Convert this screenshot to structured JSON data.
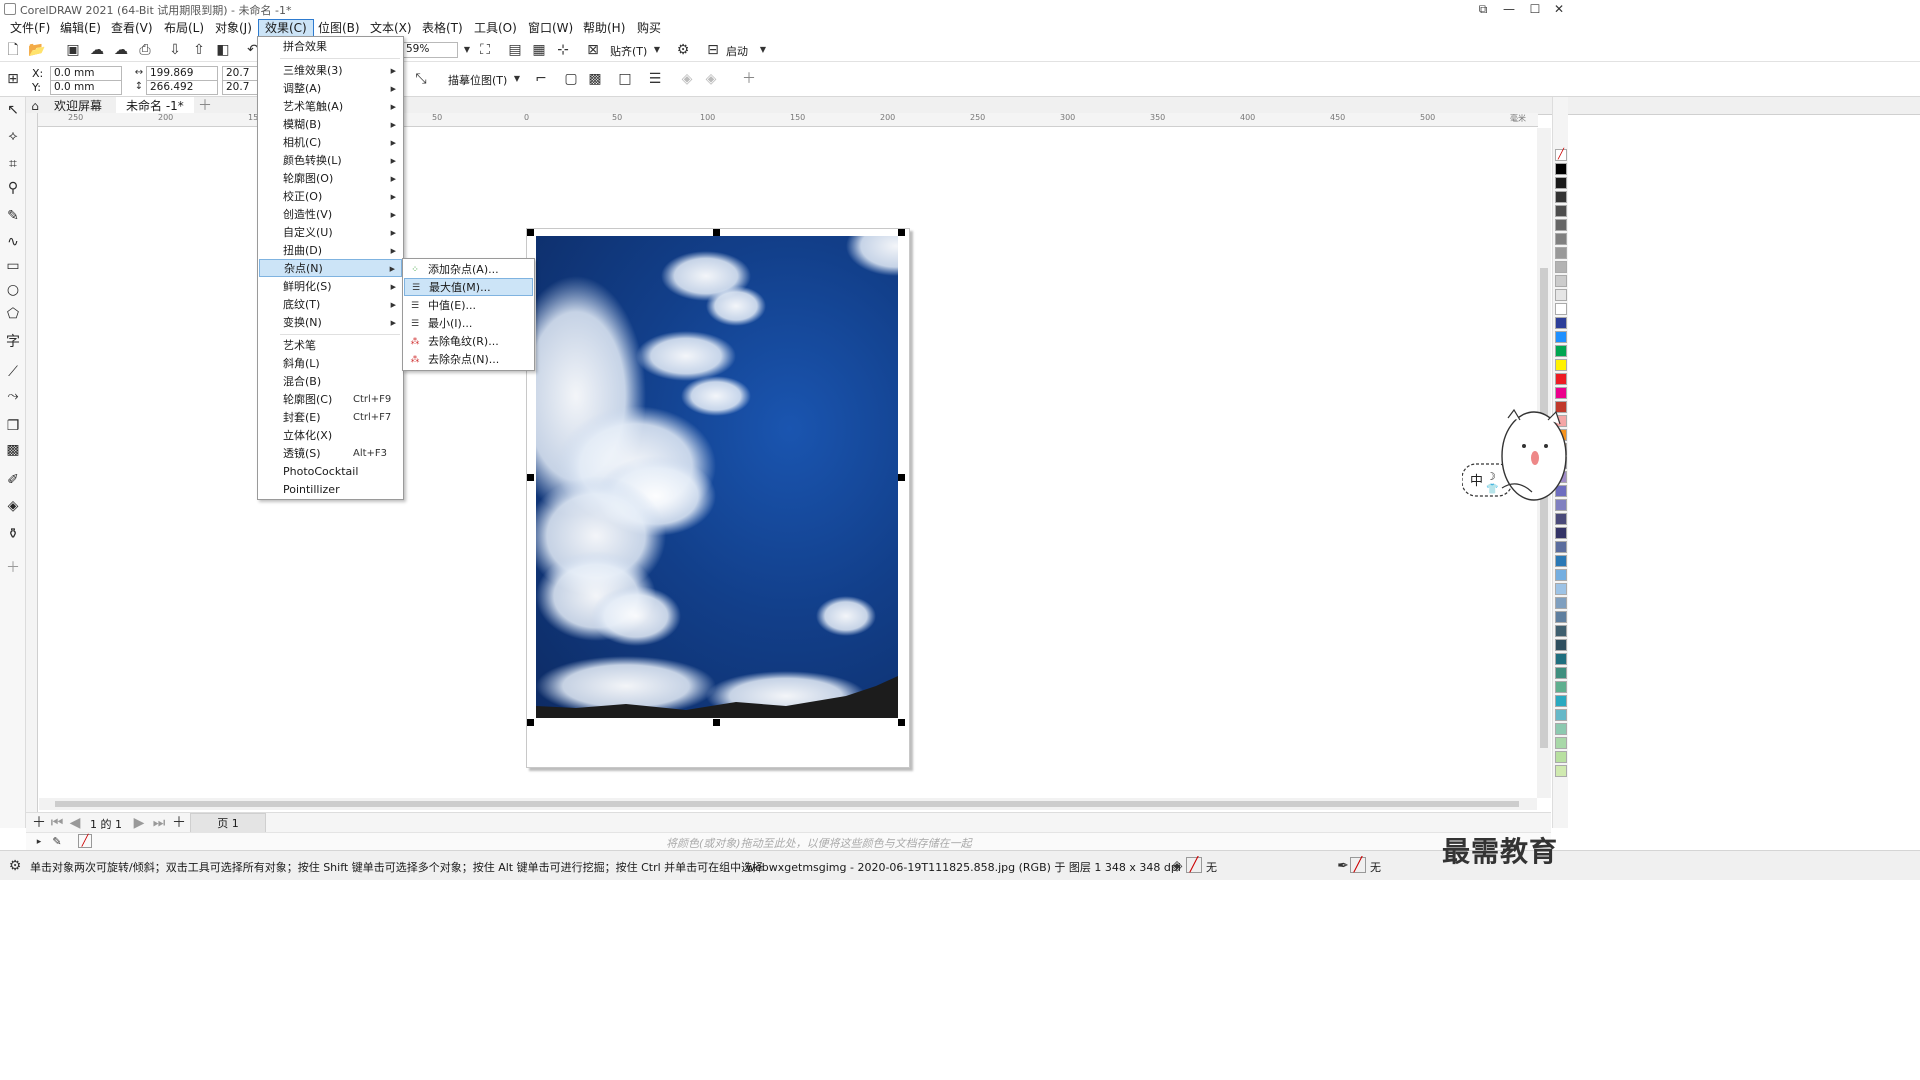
{
  "window": {
    "title": "CorelDRAW 2021 (64-Bit 试用期限到期) - 未命名 -1*"
  },
  "menubar": [
    {
      "label": "文件(F)"
    },
    {
      "label": "编辑(E)"
    },
    {
      "label": "查看(V)"
    },
    {
      "label": "布局(L)"
    },
    {
      "label": "对象(J)"
    },
    {
      "label": "效果(C)"
    },
    {
      "label": "位图(B)"
    },
    {
      "label": "文本(X)"
    },
    {
      "label": "表格(T)"
    },
    {
      "label": "工具(O)"
    },
    {
      "label": "窗口(W)"
    },
    {
      "label": "帮助(H)"
    },
    {
      "label": "购买"
    }
  ],
  "toolbar": {
    "zoom": "59%",
    "snap_label": "贴齐(T)",
    "launch_label": "启动",
    "trace_label": "描摹位图(T)"
  },
  "property_bar": {
    "x_label": "X:",
    "x_value": "0.0 mm",
    "y_label": "Y:",
    "y_value": "0.0 mm",
    "w_value": "199.869 mm",
    "h_value": "266.492 mm",
    "sw_value": "20.7",
    "sh_value": "20.7"
  },
  "tabs": {
    "welcome": "欢迎屏幕",
    "document": "未命名 -1*"
  },
  "effects_menu": {
    "items": [
      {
        "label": "拼合效果",
        "sub": false,
        "shortcut": ""
      },
      {
        "label": "三维效果(3)",
        "sub": true,
        "shortcut": ""
      },
      {
        "label": "调整(A)",
        "sub": true,
        "shortcut": ""
      },
      {
        "label": "艺术笔触(A)",
        "sub": true,
        "shortcut": ""
      },
      {
        "label": "模糊(B)",
        "sub": true,
        "shortcut": ""
      },
      {
        "label": "相机(C)",
        "sub": true,
        "shortcut": ""
      },
      {
        "label": "颜色转换(L)",
        "sub": true,
        "shortcut": ""
      },
      {
        "label": "轮廓图(O)",
        "sub": true,
        "shortcut": ""
      },
      {
        "label": "校正(O)",
        "sub": true,
        "shortcut": ""
      },
      {
        "label": "创造性(V)",
        "sub": true,
        "shortcut": ""
      },
      {
        "label": "自定义(U)",
        "sub": true,
        "shortcut": ""
      },
      {
        "label": "扭曲(D)",
        "sub": true,
        "shortcut": ""
      },
      {
        "label": "杂点(N)",
        "sub": true,
        "shortcut": ""
      },
      {
        "label": "鲜明化(S)",
        "sub": true,
        "shortcut": ""
      },
      {
        "label": "底纹(T)",
        "sub": true,
        "shortcut": ""
      },
      {
        "label": "变换(N)",
        "sub": true,
        "shortcut": ""
      },
      {
        "label": "艺术笔",
        "sub": false,
        "shortcut": ""
      },
      {
        "label": "斜角(L)",
        "sub": false,
        "shortcut": ""
      },
      {
        "label": "混合(B)",
        "sub": false,
        "shortcut": ""
      },
      {
        "label": "轮廓图(C)",
        "sub": false,
        "shortcut": "Ctrl+F9"
      },
      {
        "label": "封套(E)",
        "sub": false,
        "shortcut": "Ctrl+F7"
      },
      {
        "label": "立体化(X)",
        "sub": false,
        "shortcut": ""
      },
      {
        "label": "透镜(S)",
        "sub": false,
        "shortcut": "Alt+F3"
      },
      {
        "label": "PhotoCocktail",
        "sub": false,
        "shortcut": ""
      },
      {
        "label": "Pointillizer",
        "sub": false,
        "shortcut": ""
      }
    ]
  },
  "noise_submenu": {
    "items": [
      {
        "label": "添加杂点(A)..."
      },
      {
        "label": "最大值(M)..."
      },
      {
        "label": "中值(E)..."
      },
      {
        "label": "最小(I)..."
      },
      {
        "label": "去除龟纹(R)..."
      },
      {
        "label": "去除杂点(N)..."
      }
    ]
  },
  "pagenav": {
    "page_count": "1 的 1",
    "page_tab": "页 1"
  },
  "color_hint": "将颜色(或对象)拖动至此处，以便将这些颜色与文档存储在一起",
  "status": {
    "hint": "单击对象两次可旋转/倾斜；双击工具可选择所有对象；按住 Shift 键单击可选择多个对象；按住 Alt 键单击可进行挖掘；按住 Ctrl 并单击可在组中选择",
    "object_info": "webwxgetmsgimg - 2020-06-19T111825.858.jpg (RGB) 于 图层 1 348 x 348 dpi",
    "fill_label": "无",
    "outline_label": "无"
  },
  "ruler_h": [
    "250",
    "200",
    "150",
    "100",
    "50",
    "0",
    "50",
    "100",
    "150",
    "200",
    "250",
    "300",
    "350",
    "400",
    "450",
    "500",
    "毫米"
  ],
  "mascot_text": "中",
  "watermark": "最需教育",
  "colors": {
    "accent": "#2e7bcf",
    "highlight": "#cce4f7"
  }
}
